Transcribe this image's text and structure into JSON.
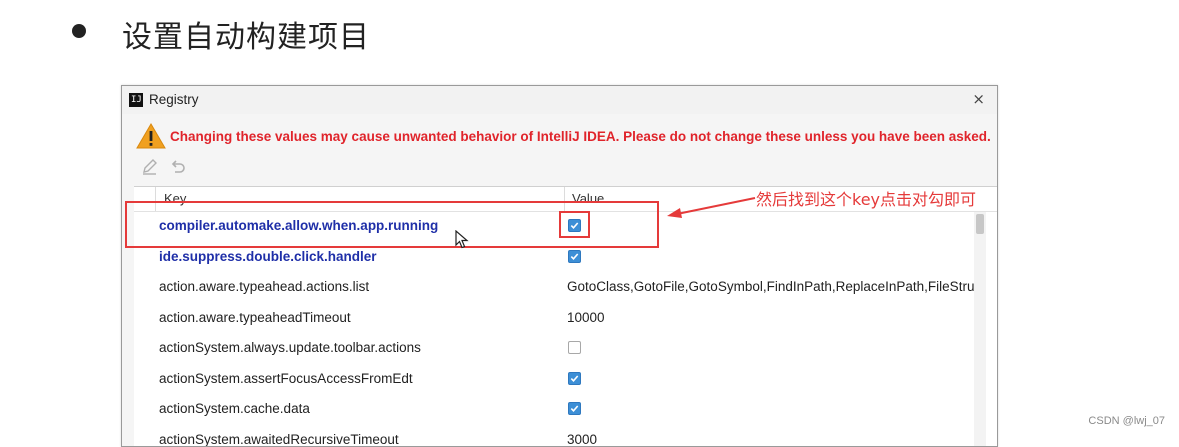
{
  "slide": {
    "title": "设置自动构建项目",
    "annotation": "然后找到这个key点击对勾即可",
    "watermark": "CSDN @lwj_07"
  },
  "dialog": {
    "app_icon_text": "IJ",
    "title": "Registry",
    "close_glyph": "×",
    "warning": "Changing these values may cause unwanted behavior of IntelliJ IDEA. Please do not change these unless you have been asked.",
    "toolbar": [
      "edit-icon",
      "revert-icon"
    ],
    "columns": {
      "key": "Key",
      "value": "Value"
    },
    "rows": [
      {
        "key": "compiler.automake.allow.when.app.running",
        "type": "checkbox",
        "checked": true,
        "modified": true
      },
      {
        "key": "ide.suppress.double.click.handler",
        "type": "checkbox",
        "checked": true,
        "modified": true
      },
      {
        "key": "action.aware.typeahead.actions.list",
        "type": "text",
        "value": "GotoClass,GotoFile,GotoSymbol,FindInPath,ReplaceInPath,FileStruc",
        "modified": false
      },
      {
        "key": "action.aware.typeaheadTimeout",
        "type": "text",
        "value": "10000",
        "modified": false
      },
      {
        "key": "actionSystem.always.update.toolbar.actions",
        "type": "checkbox",
        "checked": false,
        "modified": false
      },
      {
        "key": "actionSystem.assertFocusAccessFromEdt",
        "type": "checkbox",
        "checked": true,
        "modified": false
      },
      {
        "key": "actionSystem.cache.data",
        "type": "checkbox",
        "checked": true,
        "modified": false
      },
      {
        "key": "actionSystem.awaitedRecursiveTimeout",
        "type": "text",
        "value": "3000",
        "modified": false
      }
    ]
  },
  "colors": {
    "warning_text": "#e0242b",
    "modified_key": "#1f2fa8",
    "checkbox": "#3d8fd6",
    "annotation": "#e53a3a"
  }
}
